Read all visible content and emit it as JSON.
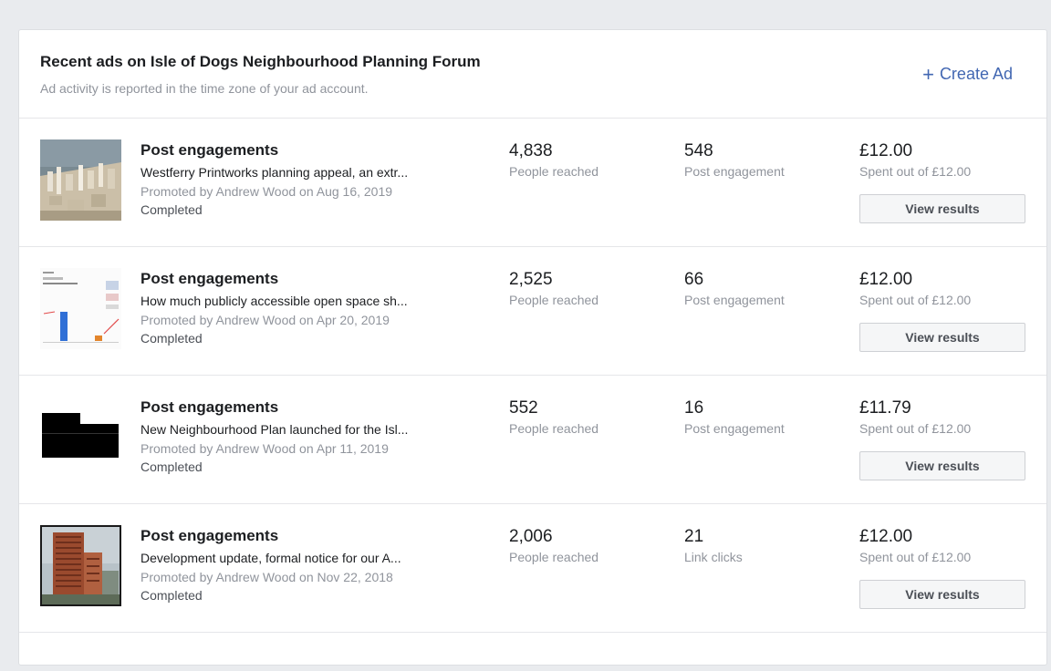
{
  "header": {
    "title": "Recent ads on Isle of Dogs Neighbourhood Planning Forum",
    "subtitle": "Ad activity is reported in the time zone of your ad account.",
    "create_ad_label": "Create Ad",
    "create_ad_icon": "plus-icon"
  },
  "colors": {
    "accent": "#4267b2",
    "muted_text": "#90949c",
    "background": "#e9ebee"
  },
  "ads": [
    {
      "thumbnail": "city-model-thumbnail",
      "type": "Post engagements",
      "description": "Westferry Printworks planning appeal, an extr...",
      "promoted": "Promoted by Andrew Wood on Aug 16, 2019",
      "status": "Completed",
      "reach_value": "4,838",
      "reach_label": "People reached",
      "engagement_value": "548",
      "engagement_label": "Post engagement",
      "spend_value": "£12.00",
      "spend_label": "Spent out of £12.00",
      "button_label": "View results"
    },
    {
      "thumbnail": "chart-document-thumbnail",
      "type": "Post engagements",
      "description": "How much publicly accessible open space sh...",
      "promoted": "Promoted by Andrew Wood on Apr 20, 2019",
      "status": "Completed",
      "reach_value": "2,525",
      "reach_label": "People reached",
      "engagement_value": "66",
      "engagement_label": "Post engagement",
      "spend_value": "£12.00",
      "spend_label": "Spent out of £12.00",
      "button_label": "View results"
    },
    {
      "thumbnail": "black-shape-thumbnail",
      "type": "Post engagements",
      "description": "New Neighbourhood Plan launched for the Isl...",
      "promoted": "Promoted by Andrew Wood on Apr 11, 2019",
      "status": "Completed",
      "reach_value": "552",
      "reach_label": "People reached",
      "engagement_value": "16",
      "engagement_label": "Post engagement",
      "spend_value": "£11.79",
      "spend_label": "Spent out of £12.00",
      "button_label": "View results"
    },
    {
      "thumbnail": "tower-building-thumbnail",
      "type": "Post engagements",
      "description": "Development update, formal notice for our A...",
      "promoted": "Promoted by Andrew Wood on Nov 22, 2018",
      "status": "Completed",
      "reach_value": "2,006",
      "reach_label": "People reached",
      "engagement_value": "21",
      "engagement_label": "Link clicks",
      "spend_value": "£12.00",
      "spend_label": "Spent out of £12.00",
      "button_label": "View results"
    }
  ]
}
